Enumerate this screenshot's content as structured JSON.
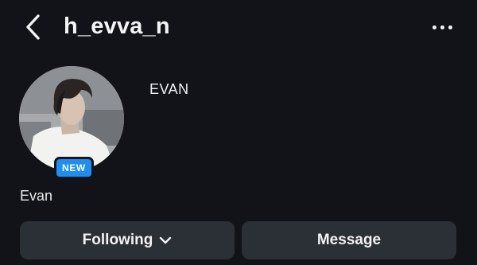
{
  "header": {
    "username": "h_evva_n",
    "back_icon": "chevron-left-icon",
    "more_icon": "more-horizontal-icon"
  },
  "profile": {
    "display_name": "EVAN",
    "bio_name": "Evan",
    "badge_label": "NEW"
  },
  "actions": {
    "following_label": "Following",
    "message_label": "Message"
  },
  "colors": {
    "background": "#111318",
    "button": "#2b2f36",
    "badge": "#1d8ff0",
    "text": "#f2f2f4"
  }
}
